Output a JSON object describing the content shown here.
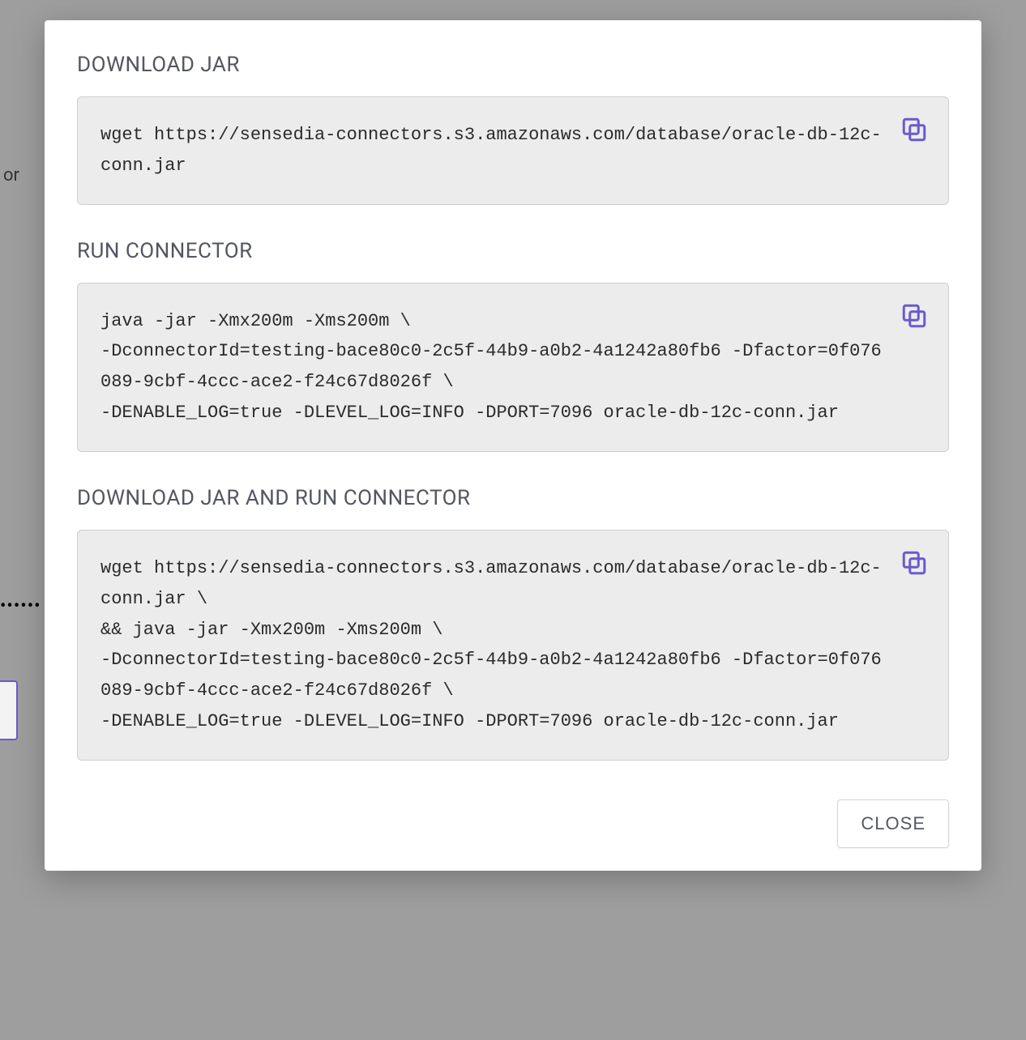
{
  "background": {
    "left_text_fragment": "or",
    "dots": "••••••"
  },
  "modal": {
    "sections": {
      "download": {
        "title": "DOWNLOAD JAR",
        "code": "wget https://sensedia-connectors.s3.amazonaws.com/database/oracle-db-12c-conn.jar"
      },
      "run": {
        "title": "RUN CONNECTOR",
        "code": "java -jar -Xmx200m -Xms200m \\\n-DconnectorId=testing-bace80c0-2c5f-44b9-a0b2-4a1242a80fb6 -Dfactor=0f076089-9cbf-4ccc-ace2-f24c67d8026f \\\n-DENABLE_LOG=true -DLEVEL_LOG=INFO -DPORT=7096 oracle-db-12c-conn.jar"
      },
      "download_run": {
        "title": "DOWNLOAD JAR AND RUN CONNECTOR",
        "code": "wget https://sensedia-connectors.s3.amazonaws.com/database/oracle-db-12c-conn.jar \\\n&& java -jar -Xmx200m -Xms200m \\\n-DconnectorId=testing-bace80c0-2c5f-44b9-a0b2-4a1242a80fb6 -Dfactor=0f076089-9cbf-4ccc-ace2-f24c67d8026f \\\n-DENABLE_LOG=true -DLEVEL_LOG=INFO -DPORT=7096 oracle-db-12c-conn.jar"
      }
    },
    "close_label": "CLOSE"
  }
}
